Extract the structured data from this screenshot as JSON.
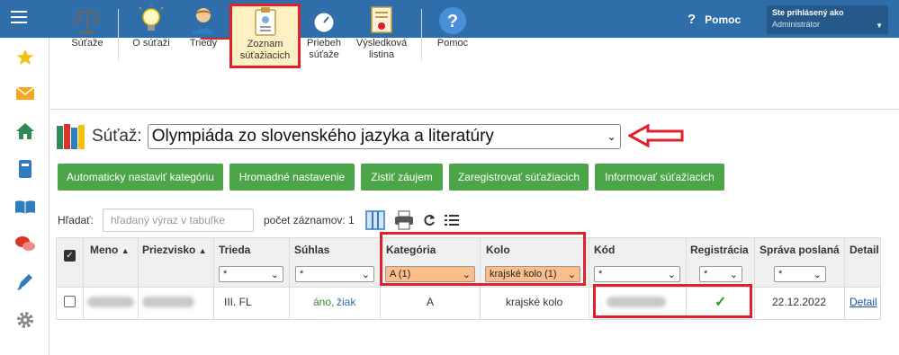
{
  "topbar": {
    "help_label": "Pomoc",
    "user_line1": "Ste prihlásený ako",
    "user_line2": "Administrátor"
  },
  "toolbar": {
    "items": [
      {
        "label": "Súťaže",
        "icon": "scales-icon"
      },
      {
        "label": "O súťaži",
        "icon": "lightbulb-icon"
      },
      {
        "label": "Triedy",
        "icon": "student-icon"
      },
      {
        "label1": "Zoznam",
        "label2": "súťažiacich",
        "icon": "clipboard-icon"
      },
      {
        "label1": "Priebeh",
        "label2": "súťaže",
        "icon": "stopwatch-icon"
      },
      {
        "label1": "Výsledková",
        "label2": "listina",
        "icon": "certificate-icon"
      },
      {
        "label": "Pomoc",
        "icon": "question-icon"
      }
    ]
  },
  "competition": {
    "label": "Súťaž:",
    "selected": "Olympiáda zo slovenského jazyka a literatúry"
  },
  "actions": {
    "auto": "Automaticky nastaviť kategóriu",
    "bulk": "Hromadné nastavenie",
    "interest": "Zistiť záujem",
    "register": "Zaregistrovať súťažiacich",
    "inform": "Informovať súťažiacich"
  },
  "search": {
    "label": "Hľadať:",
    "placeholder": "hľadaný výraz v tabuľke",
    "count_label": "počet záznamov: 1"
  },
  "table": {
    "headers": {
      "meno": "Meno",
      "priezvisko": "Priezvisko",
      "trieda": "Trieda",
      "suhlas": "Súhlas",
      "kategoria": "Kategória",
      "kolo": "Kolo",
      "kod": "Kód",
      "registracia": "Registrácia",
      "sprava": "Správa poslaná",
      "detail": "Detail"
    },
    "filters": {
      "trieda": "*",
      "suhlas": "*",
      "kategoria": "A (1)",
      "kolo": "krajské kolo (1)",
      "kod": "*",
      "registracia": "*",
      "sprava": "*"
    },
    "row": {
      "trieda": "III. FL",
      "suhlas_ano": "áno,",
      "suhlas_ziak": "žiak",
      "kategoria": "A",
      "kolo": "krajské kolo",
      "registracia": "✓",
      "sprava": "22.12.2022",
      "detail": "Detail"
    }
  },
  "colors": {
    "topbar": "#2f6ea8",
    "green_button": "#4da54a",
    "highlight_red": "#e0202a",
    "filter_orange": "#fbbd8a"
  }
}
